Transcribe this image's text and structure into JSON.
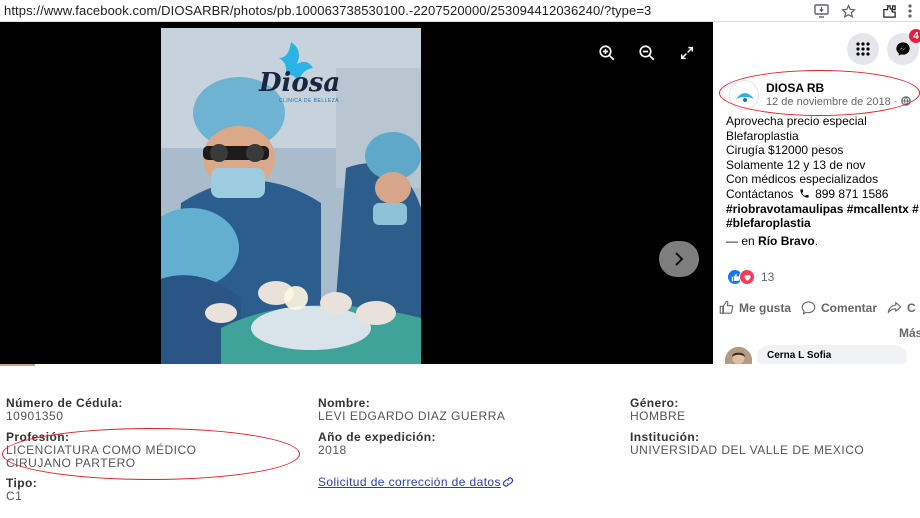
{
  "browser": {
    "url": "https://www.facebook.com/DIOSARBR/photos/pb.100063738530100.-2207520000/253094412036240/?type=3"
  },
  "photo": {
    "logo_text": "Diosa",
    "logo_subtext": "CLINICA DE BELLEZA"
  },
  "panel": {
    "notification_count": "4",
    "post": {
      "author": "DIOSA RB",
      "date": "12 de noviembre de 2018 ·",
      "lines": [
        "Aprovecha precio especial",
        "Blefaroplastia",
        "Cirugía $12000 pesos",
        "Solamente 12 y 13 de nov",
        "Con médicos especializados"
      ],
      "contact_label": "Contáctanos",
      "contact_phone": "899 871 1586",
      "hashtags_line1": "#riobravotamaulipas #mcallentx #",
      "hashtags_line2": "#blefaroplastia",
      "location_prefix": "— en",
      "location_name": "Río Bravo",
      "location_suffix": "."
    },
    "reaction_count": "13",
    "actions": {
      "like": "Me gusta",
      "comment": "Comentar",
      "share": "C"
    },
    "more_label": "Más",
    "comment_author": "Cerna L Sofia"
  },
  "registry": {
    "cedula_label": "Número de Cédula:",
    "cedula_value": "10901350",
    "nombre_label": "Nombre:",
    "nombre_value": "LEVI EDGARDO DIAZ GUERRA",
    "genero_label": "Género:",
    "genero_value": "HOMBRE",
    "profesion_label": "Profesión:",
    "profesion_value_1": "LICENCIATURA COMO MÉDICO",
    "profesion_value_2": "CIRUJANO PARTERO",
    "anio_label": "Año de expedición:",
    "anio_value": "2018",
    "institucion_label": "Institución:",
    "institucion_value": "UNIVERSIDAD DEL VALLE DE MEXICO",
    "tipo_label": "Tipo:",
    "tipo_value": "C1",
    "correction_link": "Solicitud de corrección de datos"
  }
}
